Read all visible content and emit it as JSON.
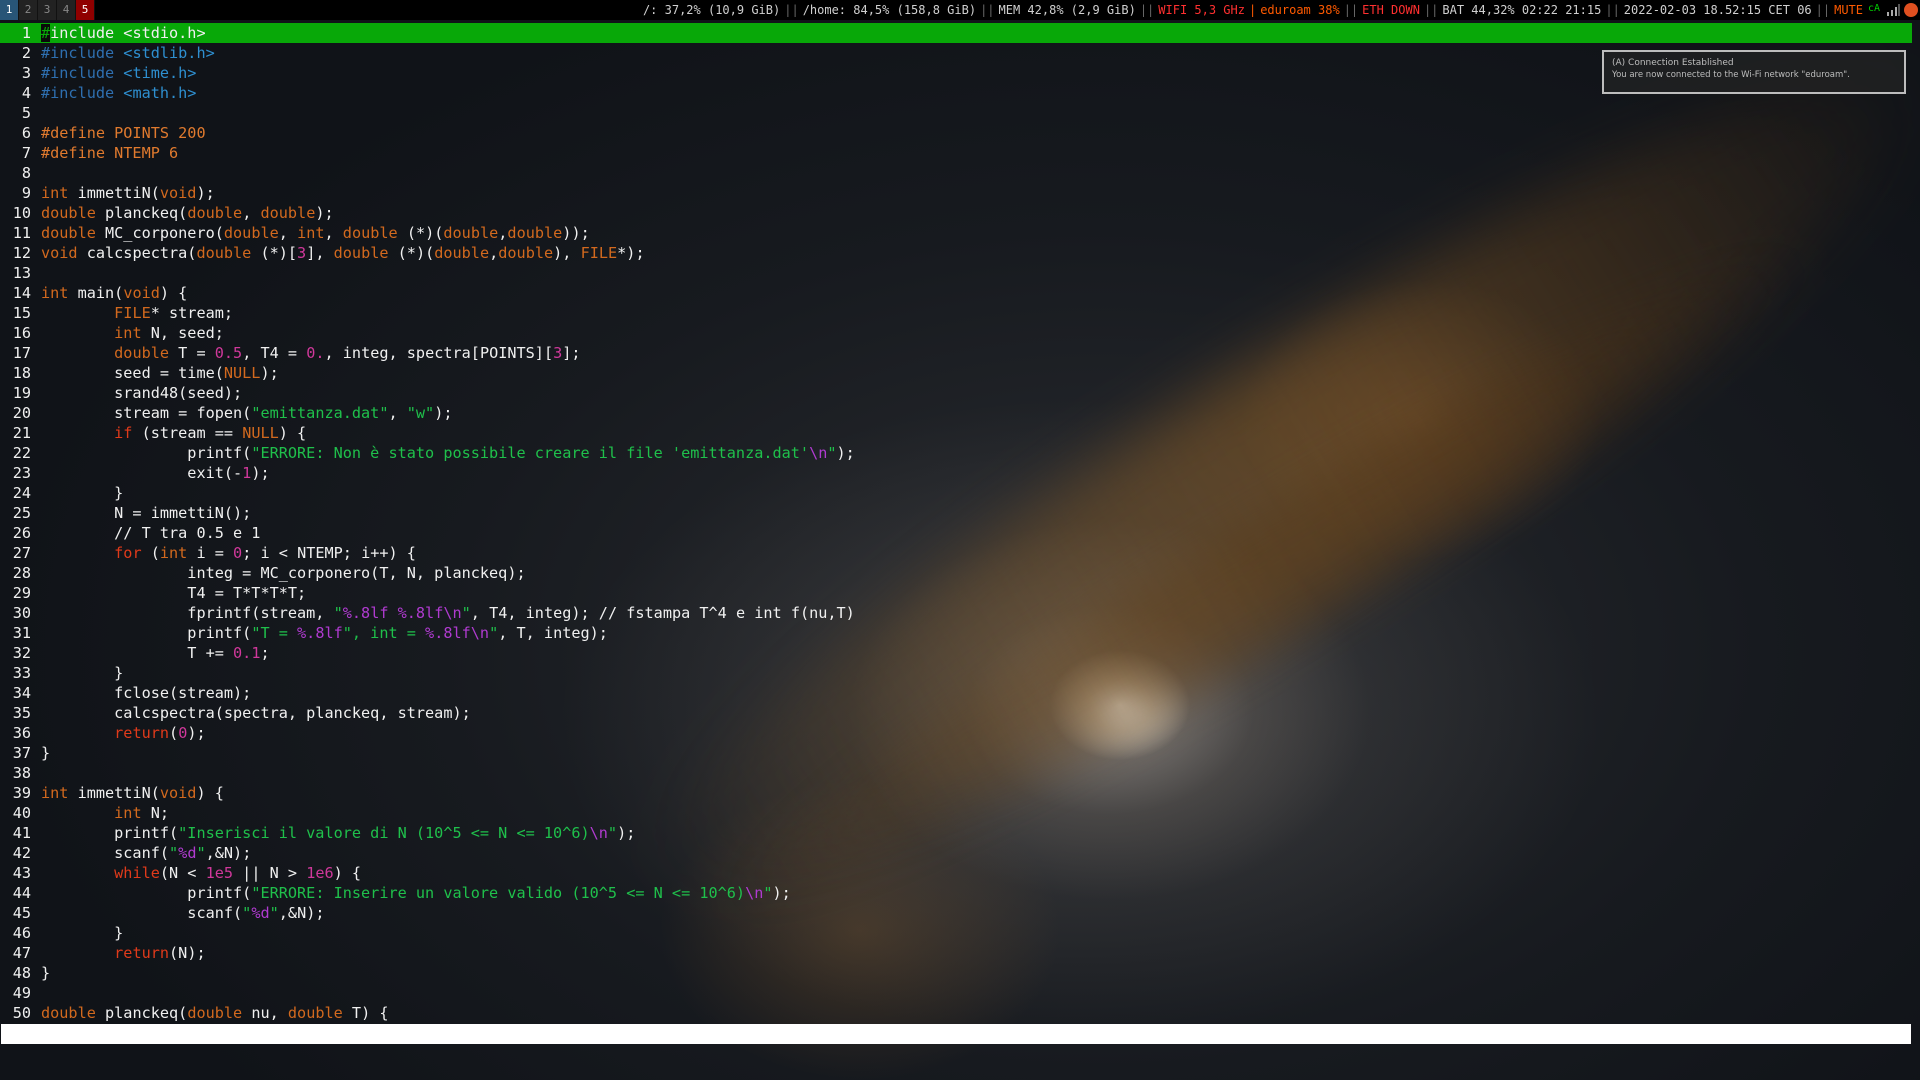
{
  "workspaces": [
    {
      "label": "1",
      "state": "focused"
    },
    {
      "label": "2",
      "state": "normal"
    },
    {
      "label": "3",
      "state": "normal"
    },
    {
      "label": "4",
      "state": "normal"
    },
    {
      "label": "5",
      "state": "urgent"
    }
  ],
  "status": {
    "disk_root": "/: 37,2% (10,9 GiB)",
    "disk_home": "/home: 84,5% (158,8 GiB)",
    "mem": "MEM 42,8% (2,9 GiB)",
    "wifi": "WIFI 5,3 GHz",
    "ssid": "eduroam 38%",
    "eth": "ETH DOWN",
    "battery": "BAT 44,32% 02:22 21:15",
    "datetime": "2022-02-03 18.52:15 CET 06",
    "volume": "MUTE",
    "tray_label": "cA",
    "separator": "||",
    "colors": {
      "good": "#00d000",
      "bad": "#ff3030",
      "degraded": "#ff5a00"
    }
  },
  "notification": {
    "title": "(A) Connection Established",
    "body": "You are now connected to the Wi-Fi network \"eduroam\"."
  },
  "editor": {
    "current_line": 1,
    "colors": {
      "current_line_bg": "#08a808"
    },
    "lines": [
      {
        "n": 1,
        "tokens": [
          [
            "#",
            "cursor"
          ],
          [
            "include <stdio.h>",
            "default"
          ]
        ]
      },
      {
        "n": 2,
        "tokens": [
          [
            "#include",
            "pp"
          ],
          [
            " <stdlib.h>",
            "include"
          ]
        ]
      },
      {
        "n": 3,
        "tokens": [
          [
            "#include",
            "pp"
          ],
          [
            " <time.h>",
            "include"
          ]
        ]
      },
      {
        "n": 4,
        "tokens": [
          [
            "#include",
            "pp"
          ],
          [
            " <math.h>",
            "include"
          ]
        ]
      },
      {
        "n": 5,
        "tokens": []
      },
      {
        "n": 6,
        "tokens": [
          [
            "#define POINTS 200",
            "macro"
          ]
        ]
      },
      {
        "n": 7,
        "tokens": [
          [
            "#define NTEMP 6",
            "macro"
          ]
        ]
      },
      {
        "n": 8,
        "tokens": []
      },
      {
        "n": 9,
        "tokens": [
          [
            "int",
            "type"
          ],
          [
            " immettiN(",
            "default"
          ],
          [
            "void",
            "type"
          ],
          [
            ");",
            "default"
          ]
        ]
      },
      {
        "n": 10,
        "tokens": [
          [
            "double",
            "type"
          ],
          [
            " planckeq(",
            "default"
          ],
          [
            "double",
            "type"
          ],
          [
            ", ",
            "default"
          ],
          [
            "double",
            "type"
          ],
          [
            ");",
            "default"
          ]
        ]
      },
      {
        "n": 11,
        "tokens": [
          [
            "double",
            "type"
          ],
          [
            " MC_corponero(",
            "default"
          ],
          [
            "double",
            "type"
          ],
          [
            ", ",
            "default"
          ],
          [
            "int",
            "type"
          ],
          [
            ", ",
            "default"
          ],
          [
            "double",
            "type"
          ],
          [
            " (*)(",
            "default"
          ],
          [
            "double",
            "type"
          ],
          [
            ",",
            "default"
          ],
          [
            "double",
            "type"
          ],
          [
            "));",
            "default"
          ]
        ]
      },
      {
        "n": 12,
        "tokens": [
          [
            "void",
            "type"
          ],
          [
            " calcspectra(",
            "default"
          ],
          [
            "double",
            "type"
          ],
          [
            " (*)[",
            "default"
          ],
          [
            "3",
            "num"
          ],
          [
            "], ",
            "default"
          ],
          [
            "double",
            "type"
          ],
          [
            " (*)(",
            "default"
          ],
          [
            "double",
            "type"
          ],
          [
            ",",
            "default"
          ],
          [
            "double",
            "type"
          ],
          [
            "), ",
            "default"
          ],
          [
            "FILE",
            "type"
          ],
          [
            "*);",
            "default"
          ]
        ]
      },
      {
        "n": 13,
        "tokens": []
      },
      {
        "n": 14,
        "tokens": [
          [
            "int",
            "type"
          ],
          [
            " main(",
            "default"
          ],
          [
            "void",
            "type"
          ],
          [
            ") {",
            "default"
          ]
        ]
      },
      {
        "n": 15,
        "tokens": [
          [
            "        ",
            "default"
          ],
          [
            "FILE",
            "type"
          ],
          [
            "* stream;",
            "default"
          ]
        ]
      },
      {
        "n": 16,
        "tokens": [
          [
            "        ",
            "default"
          ],
          [
            "int",
            "type"
          ],
          [
            " N, seed;",
            "default"
          ]
        ]
      },
      {
        "n": 17,
        "tokens": [
          [
            "        ",
            "default"
          ],
          [
            "double",
            "type"
          ],
          [
            " T = ",
            "default"
          ],
          [
            "0.5",
            "num"
          ],
          [
            ", T4 = ",
            "default"
          ],
          [
            "0.",
            "num"
          ],
          [
            ", integ, spectra[POINTS][",
            "default"
          ],
          [
            "3",
            "num"
          ],
          [
            "];",
            "default"
          ]
        ]
      },
      {
        "n": 18,
        "tokens": [
          [
            "        seed = time(",
            "default"
          ],
          [
            "NULL",
            "type"
          ],
          [
            ");",
            "default"
          ]
        ]
      },
      {
        "n": 19,
        "tokens": [
          [
            "        srand48(seed);",
            "default"
          ]
        ]
      },
      {
        "n": 20,
        "tokens": [
          [
            "        stream = fopen(",
            "default"
          ],
          [
            "\"emittanza.dat\"",
            "str"
          ],
          [
            ", ",
            "default"
          ],
          [
            "\"w\"",
            "str"
          ],
          [
            ");",
            "default"
          ]
        ]
      },
      {
        "n": 21,
        "tokens": [
          [
            "        ",
            "default"
          ],
          [
            "if",
            "kw"
          ],
          [
            " (stream == ",
            "default"
          ],
          [
            "NULL",
            "type"
          ],
          [
            ") {",
            "default"
          ]
        ]
      },
      {
        "n": 22,
        "tokens": [
          [
            "                printf(",
            "default"
          ],
          [
            "\"ERRORE: Non è stato possibile creare il file 'emittanza.dat'",
            "str"
          ],
          [
            "\\n",
            "fmt"
          ],
          [
            "\"",
            "str"
          ],
          [
            ");",
            "default"
          ]
        ]
      },
      {
        "n": 23,
        "tokens": [
          [
            "                exit(-",
            "default"
          ],
          [
            "1",
            "num"
          ],
          [
            ");",
            "default"
          ]
        ]
      },
      {
        "n": 24,
        "tokens": [
          [
            "        }",
            "default"
          ]
        ]
      },
      {
        "n": 25,
        "tokens": [
          [
            "        N = immettiN();",
            "default"
          ]
        ]
      },
      {
        "n": 26,
        "tokens": [
          [
            "        // T tra 0.5 e 1",
            "comment"
          ]
        ]
      },
      {
        "n": 27,
        "tokens": [
          [
            "        ",
            "default"
          ],
          [
            "for",
            "kw"
          ],
          [
            " (",
            "default"
          ],
          [
            "int",
            "type"
          ],
          [
            " i = ",
            "default"
          ],
          [
            "0",
            "num"
          ],
          [
            "; i < NTEMP; i++) {",
            "default"
          ]
        ]
      },
      {
        "n": 28,
        "tokens": [
          [
            "                integ = MC_corponero(T, N, planckeq);",
            "default"
          ]
        ]
      },
      {
        "n": 29,
        "tokens": [
          [
            "                T4 = T*T*T*T;",
            "default"
          ]
        ]
      },
      {
        "n": 30,
        "tokens": [
          [
            "                fprintf(stream, ",
            "default"
          ],
          [
            "\"",
            "str"
          ],
          [
            "%.8lf %.8lf\\n",
            "fmt"
          ],
          [
            "\"",
            "str"
          ],
          [
            ", T4, integ); // fstampa T^4 e int f(nu,T)",
            "default"
          ]
        ]
      },
      {
        "n": 31,
        "tokens": [
          [
            "                printf(",
            "default"
          ],
          [
            "\"T = ",
            "str"
          ],
          [
            "%.8lf",
            "fmt"
          ],
          [
            "\", int = ",
            "str"
          ],
          [
            "%.8lf\\n",
            "fmt"
          ],
          [
            "\"",
            "str"
          ],
          [
            ", T, integ);",
            "default"
          ]
        ]
      },
      {
        "n": 32,
        "tokens": [
          [
            "                T += ",
            "default"
          ],
          [
            "0.1",
            "num"
          ],
          [
            ";",
            "default"
          ]
        ]
      },
      {
        "n": 33,
        "tokens": [
          [
            "        }",
            "default"
          ]
        ]
      },
      {
        "n": 34,
        "tokens": [
          [
            "        fclose(stream);",
            "default"
          ]
        ]
      },
      {
        "n": 35,
        "tokens": [
          [
            "        calcspectra(spectra, planckeq, stream);",
            "default"
          ]
        ]
      },
      {
        "n": 36,
        "tokens": [
          [
            "        ",
            "default"
          ],
          [
            "return",
            "kw"
          ],
          [
            "(",
            "default"
          ],
          [
            "0",
            "num"
          ],
          [
            ");",
            "default"
          ]
        ]
      },
      {
        "n": 37,
        "tokens": [
          [
            "}",
            "default"
          ]
        ]
      },
      {
        "n": 38,
        "tokens": []
      },
      {
        "n": 39,
        "tokens": [
          [
            "int",
            "type"
          ],
          [
            " immettiN(",
            "default"
          ],
          [
            "void",
            "type"
          ],
          [
            ") {",
            "default"
          ]
        ]
      },
      {
        "n": 40,
        "tokens": [
          [
            "        ",
            "default"
          ],
          [
            "int",
            "type"
          ],
          [
            " N;",
            "default"
          ]
        ]
      },
      {
        "n": 41,
        "tokens": [
          [
            "        printf(",
            "default"
          ],
          [
            "\"Inserisci il valore di N (10^5 <= N <= 10^6)",
            "str"
          ],
          [
            "\\n",
            "fmt"
          ],
          [
            "\"",
            "str"
          ],
          [
            ");",
            "default"
          ]
        ]
      },
      {
        "n": 42,
        "tokens": [
          [
            "        scanf(",
            "default"
          ],
          [
            "\"",
            "str"
          ],
          [
            "%d",
            "fmt"
          ],
          [
            "\"",
            "str"
          ],
          [
            ",&N);",
            "default"
          ]
        ]
      },
      {
        "n": 43,
        "tokens": [
          [
            "        ",
            "default"
          ],
          [
            "while",
            "kw"
          ],
          [
            "(N < ",
            "default"
          ],
          [
            "1e5",
            "num"
          ],
          [
            " || N > ",
            "default"
          ],
          [
            "1e6",
            "num"
          ],
          [
            ") {",
            "default"
          ]
        ]
      },
      {
        "n": 44,
        "tokens": [
          [
            "                printf(",
            "default"
          ],
          [
            "\"ERRORE: Inserire un valore valido (10^5 <= N <= 10^6)",
            "str"
          ],
          [
            "\\n",
            "fmt"
          ],
          [
            "\"",
            "str"
          ],
          [
            ");",
            "default"
          ]
        ]
      },
      {
        "n": 45,
        "tokens": [
          [
            "                scanf(",
            "default"
          ],
          [
            "\"",
            "str"
          ],
          [
            "%d",
            "fmt"
          ],
          [
            "\"",
            "str"
          ],
          [
            ",&N);",
            "default"
          ]
        ]
      },
      {
        "n": 46,
        "tokens": [
          [
            "        }",
            "default"
          ]
        ]
      },
      {
        "n": 47,
        "tokens": [
          [
            "        ",
            "default"
          ],
          [
            "return",
            "kw"
          ],
          [
            "(N);",
            "default"
          ]
        ]
      },
      {
        "n": 48,
        "tokens": [
          [
            "}",
            "default"
          ]
        ]
      },
      {
        "n": 49,
        "tokens": []
      },
      {
        "n": 50,
        "tokens": [
          [
            "double",
            "type"
          ],
          [
            " planckeq(",
            "default"
          ],
          [
            "double",
            "type"
          ],
          [
            " nu, ",
            "default"
          ],
          [
            "double",
            "type"
          ],
          [
            " T) {",
            "default"
          ]
        ]
      }
    ]
  },
  "command_line": ""
}
